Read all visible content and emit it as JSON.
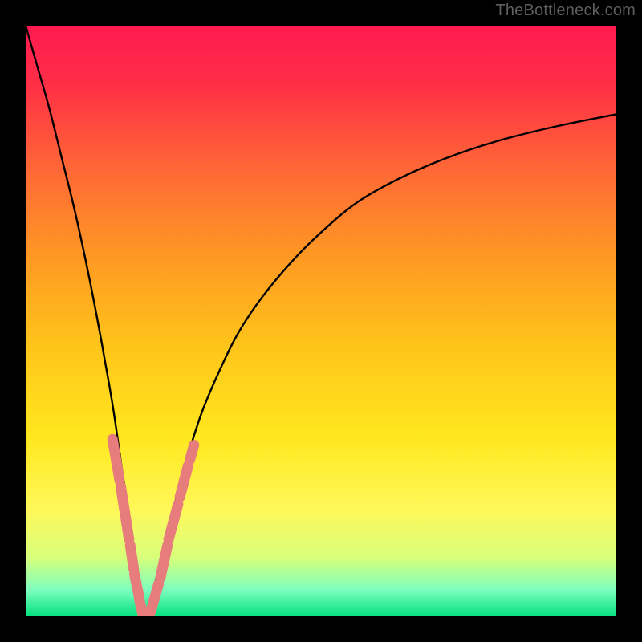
{
  "watermark": "TheBottleneck.com",
  "colors": {
    "gradient_stops": [
      {
        "offset": 0.0,
        "color": "#ff1a50"
      },
      {
        "offset": 0.1,
        "color": "#ff2f46"
      },
      {
        "offset": 0.25,
        "color": "#ff6a35"
      },
      {
        "offset": 0.4,
        "color": "#ff9b22"
      },
      {
        "offset": 0.55,
        "color": "#ffc61a"
      },
      {
        "offset": 0.7,
        "color": "#ffe81f"
      },
      {
        "offset": 0.82,
        "color": "#fff85a"
      },
      {
        "offset": 0.9,
        "color": "#d8ff7a"
      },
      {
        "offset": 0.955,
        "color": "#7dffbe"
      },
      {
        "offset": 1.0,
        "color": "#05e07d"
      }
    ],
    "curve": "#000000",
    "marker": "#e77c7c"
  },
  "chart_data": {
    "type": "line",
    "title": "",
    "xlabel": "",
    "ylabel": "",
    "xlim": [
      0,
      100
    ],
    "ylim": [
      0,
      100
    ],
    "series": [
      {
        "name": "bottleneck-curve",
        "x": [
          0,
          2,
          4,
          6,
          8,
          10,
          12,
          14,
          15,
          16,
          17,
          18,
          18.5,
          19,
          19.5,
          20,
          20.8,
          22,
          24,
          26,
          28,
          30,
          33,
          36,
          40,
          45,
          50,
          56,
          63,
          71,
          80,
          90,
          100
        ],
        "values": [
          100,
          93,
          86,
          78,
          70,
          61,
          51,
          40,
          34,
          27,
          20,
          12,
          8,
          4,
          1.5,
          0,
          1.5,
          6,
          14,
          22,
          29,
          35,
          42,
          48,
          54,
          60,
          65,
          70,
          74,
          77.5,
          80.5,
          83,
          85
        ]
      }
    ],
    "markers": {
      "name": "highlighted-segments",
      "segments": [
        {
          "x0": 14.7,
          "y0": 30,
          "x1": 15.9,
          "y1": 23
        },
        {
          "x0": 16.1,
          "y0": 22,
          "x1": 17.5,
          "y1": 13
        },
        {
          "x0": 17.7,
          "y0": 12,
          "x1": 18.3,
          "y1": 8
        },
        {
          "x0": 18.4,
          "y0": 7.2,
          "x1": 19.2,
          "y1": 3.3
        },
        {
          "x0": 19.2,
          "y0": 3.0,
          "x1": 19.7,
          "y1": 0.8
        },
        {
          "x0": 19.8,
          "y0": 0.4,
          "x1": 21.0,
          "y1": 0.4
        },
        {
          "x0": 21.2,
          "y0": 0.9,
          "x1": 22.5,
          "y1": 5.5
        },
        {
          "x0": 22.8,
          "y0": 6.5,
          "x1": 24.0,
          "y1": 12.0
        },
        {
          "x0": 24.2,
          "y0": 13.0,
          "x1": 25.8,
          "y1": 19.0
        },
        {
          "x0": 26.1,
          "y0": 20.2,
          "x1": 27.5,
          "y1": 25.5
        },
        {
          "x0": 27.8,
          "y0": 26.5,
          "x1": 28.5,
          "y1": 29.0
        }
      ]
    }
  }
}
